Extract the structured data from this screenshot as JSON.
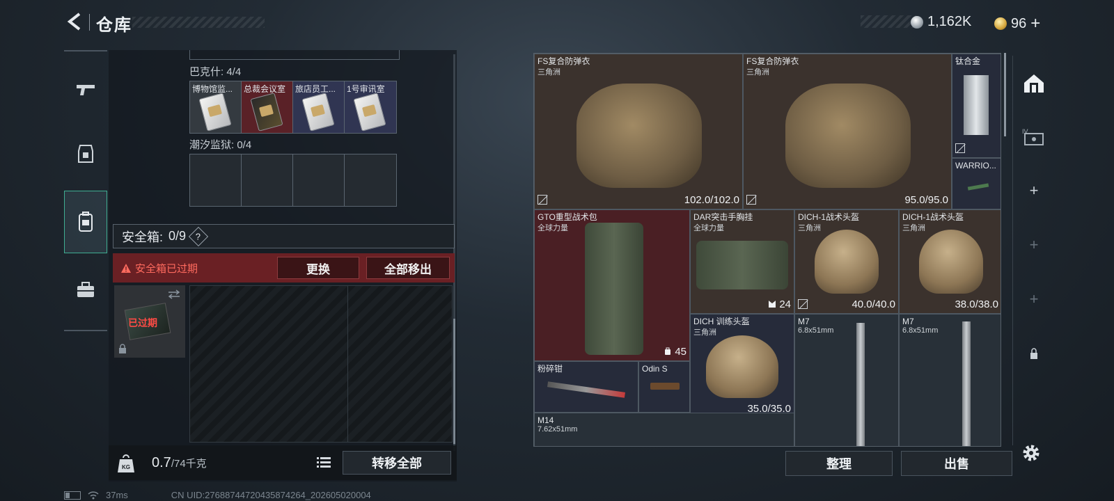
{
  "header": {
    "title": "仓库",
    "currency": [
      {
        "icon": "silver-coin-icon",
        "value": "1,162K"
      },
      {
        "icon": "gold-coin-icon",
        "value": "96"
      }
    ],
    "add_symbol": "+"
  },
  "left_nav": [
    "weapon-icon",
    "armor-icon",
    "backpack-icon",
    "toolbox-icon"
  ],
  "key_sections": [
    {
      "label": "巴克什: 4/4",
      "keys": [
        "博物馆监...",
        "总裁会议室",
        "旅店员工...",
        "1号审讯室"
      ]
    },
    {
      "label": "潮汐监狱: 0/4",
      "keys": [
        "",
        "",
        "",
        ""
      ]
    }
  ],
  "safe_box": {
    "label": "安全箱:",
    "count": "0/9",
    "help": "?",
    "expired_warning": "安全箱已过期",
    "replace_button": "更换",
    "remove_all_button": "全部移出",
    "thumb_label": "已过期"
  },
  "footer_left": {
    "weight_value": "0.7",
    "weight_cap": "/74千克",
    "weight_icon_text": "KG",
    "transfer_all": "转移全部"
  },
  "items": [
    {
      "name": "FS复合防弹衣",
      "sub": "三角洲",
      "value": "102.0/102.0",
      "bg": "brown"
    },
    {
      "name": "FS复合防弹衣",
      "sub": "三角洲",
      "value": "95.0/95.0",
      "bg": "brown"
    },
    {
      "name": "钛合金",
      "sub": "",
      "value": "",
      "bg": "blue"
    },
    {
      "name": "WARRIO...",
      "sub": "",
      "value": "",
      "bg": "blue"
    },
    {
      "name": "GTO重型战术包",
      "sub": "全球力量",
      "value": "45",
      "bg": "red"
    },
    {
      "name": "DAR突击手胸挂",
      "sub": "全球力量",
      "value": "24",
      "bg": "brown"
    },
    {
      "name": "DICH-1战术头盔",
      "sub": "三角洲",
      "value": "40.0/40.0",
      "bg": "brown"
    },
    {
      "name": "DICH-1战术头盔",
      "sub": "三角洲",
      "value": "38.0/38.0",
      "bg": "brown"
    },
    {
      "name": "DICH 训练头盔",
      "sub": "三角洲",
      "value": "35.0/35.0",
      "bg": "blue"
    },
    {
      "name": "M7",
      "sub": "6.8x51mm",
      "value": "",
      "bg": "gray"
    },
    {
      "name": "M7",
      "sub": "6.8x51mm",
      "value": "",
      "bg": "gray"
    },
    {
      "name": "粉碎钳",
      "sub": "",
      "value": "",
      "bg": "blue"
    },
    {
      "name": "Odin S",
      "sub": "",
      "value": "",
      "bg": "blue"
    },
    {
      "name": "M14",
      "sub": "7.62x51mm",
      "value": "",
      "bg": "gray"
    }
  ],
  "footer_right": {
    "sort_button": "整理",
    "sell_button": "出售"
  },
  "right_nav": [
    "home-icon",
    "case-icon",
    "plus-icon",
    "plus-icon",
    "plus-icon",
    "lock-icon"
  ],
  "right_nav_case_text": "IV",
  "status": {
    "ping": "37ms",
    "uid": "CN UID:2768874472043587426​4_202605020004"
  },
  "colors": {
    "accent_green": "#3fae92",
    "warning_red": "#ff6a5e",
    "expired_bg": "#6a2024"
  }
}
